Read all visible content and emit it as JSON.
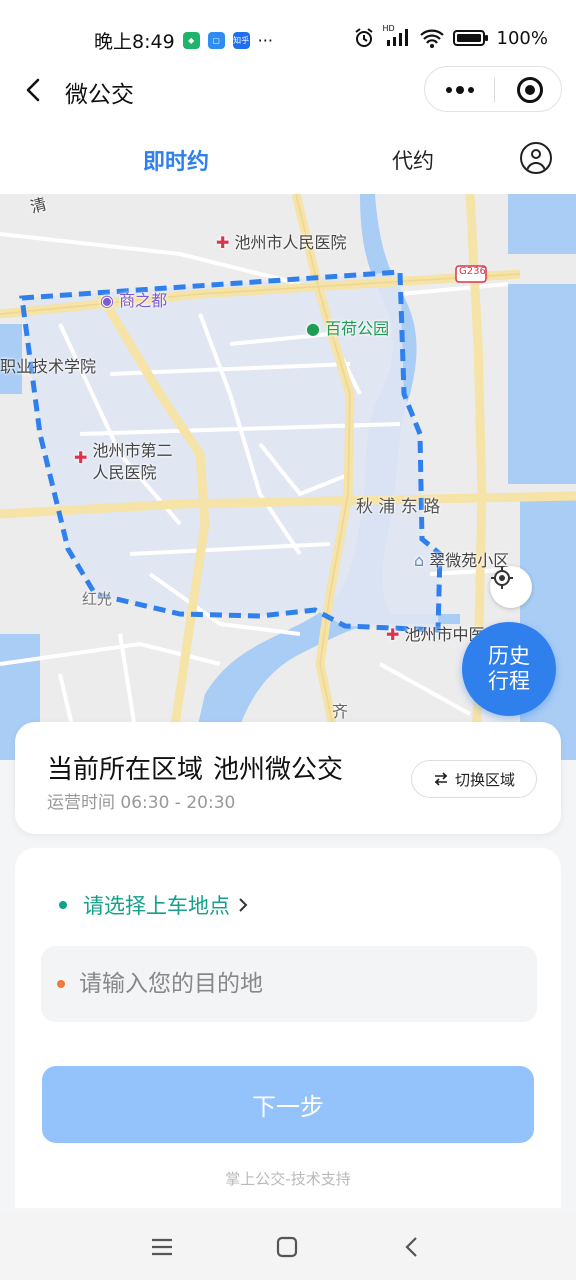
{
  "status": {
    "time": "晚上8:49",
    "app_badge": "知乎",
    "more": "···",
    "hd": "HD",
    "battery": "100%"
  },
  "nav": {
    "title": "微公交"
  },
  "tabs": {
    "now": "即时约",
    "proxy": "代约"
  },
  "map": {
    "labels": {
      "hospital1": "池州市人民医院",
      "mall": "商之都",
      "park": "百荷公园",
      "college": "职业技术学院",
      "hospital2_line1": "池州市第二",
      "hospital2_line2": "人民医院",
      "road_qiupu": "秋 浦 东 路",
      "community": "翠微苑小区",
      "hongguang": "红光",
      "hospital3": "池州市中医",
      "road_g236": "G236",
      "road_top": "清",
      "road_bottom": "齐"
    },
    "history_line1": "历史",
    "history_line2": "行程"
  },
  "region": {
    "label": "当前所在区域",
    "name": "池州微公交",
    "hours": "运营时间 06:30 - 20:30",
    "switch": "切换区域"
  },
  "form": {
    "pickup": "请选择上车地点",
    "dest_placeholder": "请输入您的目的地",
    "next": "下一步",
    "powered": "掌上公交-技术支持"
  },
  "colors": {
    "primary": "#2f80ed",
    "pickup": "#14a08a",
    "dest_dot": "#f07a3c",
    "button_disabled": "#94c2fb"
  }
}
